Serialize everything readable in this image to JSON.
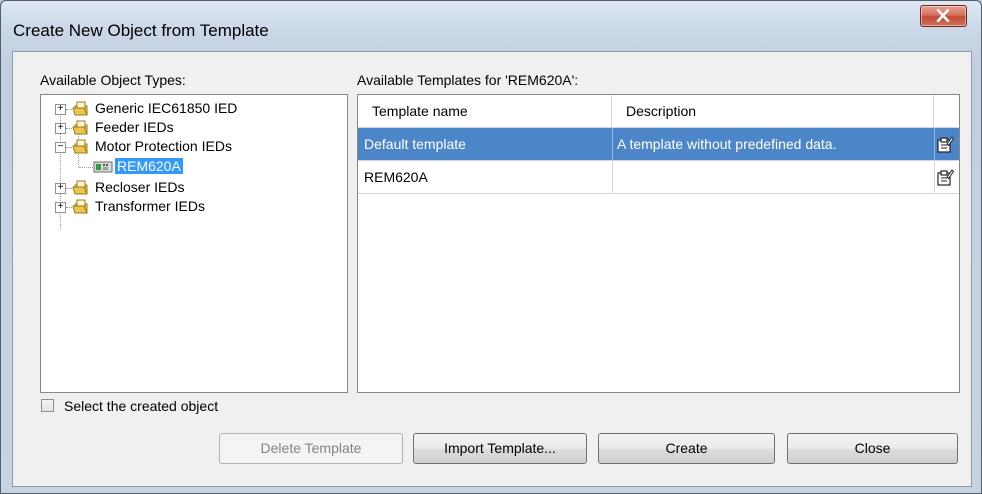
{
  "window": {
    "title": "Create New Object from Template"
  },
  "left_panel": {
    "label": "Available Object Types:",
    "tree": [
      {
        "label": "Generic IEC61850 IED",
        "expander": "+"
      },
      {
        "label": "Feeder IEDs",
        "expander": "+"
      },
      {
        "label": "Motor Protection IEDs",
        "expander": "−"
      },
      {
        "label": "REM620A",
        "selected": true
      },
      {
        "label": "Recloser IEDs",
        "expander": "+"
      },
      {
        "label": "Transformer IEDs",
        "expander": "+"
      }
    ]
  },
  "right_panel": {
    "label": "Available Templates for 'REM620A':",
    "columns": [
      "Template name",
      "Description"
    ],
    "rows": [
      {
        "name": "Default template",
        "description": "A template without predefined data.",
        "selected": true
      },
      {
        "name": "REM620A",
        "description": ""
      }
    ]
  },
  "checkbox": {
    "label": "Select the created object",
    "checked": false
  },
  "buttons": {
    "delete": "Delete Template",
    "import": "Import Template...",
    "create": "Create",
    "close": "Close"
  },
  "colors": {
    "selection": "#4d86c8",
    "tree_selection": "#3399ff",
    "close_button": "#c24a33"
  },
  "icons": [
    "close-icon",
    "folder-icon",
    "ied-device-icon",
    "edit-properties-icon",
    "expand-icon",
    "collapse-icon"
  ]
}
